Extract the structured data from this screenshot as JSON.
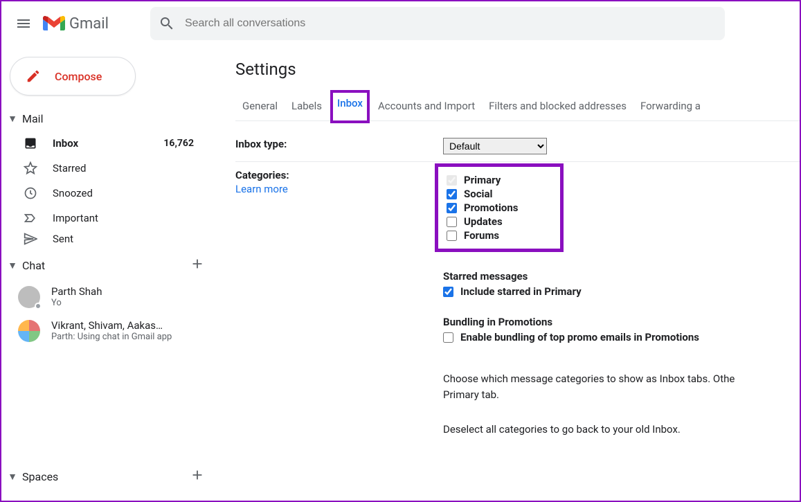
{
  "header": {
    "app_name": "Gmail",
    "search_placeholder": "Search all conversations"
  },
  "compose_label": "Compose",
  "sections": {
    "mail": "Mail",
    "chat": "Chat",
    "spaces": "Spaces"
  },
  "nav": {
    "inbox": {
      "label": "Inbox",
      "count": "16,762"
    },
    "starred": {
      "label": "Starred"
    },
    "snoozed": {
      "label": "Snoozed"
    },
    "important": {
      "label": "Important"
    },
    "sent": {
      "label": "Sent"
    }
  },
  "chats": [
    {
      "name": "Parth Shah",
      "sub": "Yo"
    },
    {
      "name": "Vikrant, Shivam, Aakas…",
      "sub": "Parth: Using chat in Gmail app"
    }
  ],
  "main": {
    "title": "Settings",
    "tabs": {
      "general": "General",
      "labels": "Labels",
      "inbox": "Inbox",
      "accounts": "Accounts and Import",
      "filters": "Filters and blocked addresses",
      "forwarding": "Forwarding a"
    },
    "inbox_type_label": "Inbox type:",
    "inbox_type_value": "Default",
    "categories_label": "Categories:",
    "learn_more": "Learn more",
    "cats": {
      "primary": {
        "label": "Primary",
        "checked": true,
        "disabled": true
      },
      "social": {
        "label": "Social",
        "checked": true
      },
      "promotions": {
        "label": "Promotions",
        "checked": true
      },
      "updates": {
        "label": "Updates",
        "checked": false
      },
      "forums": {
        "label": "Forums",
        "checked": false
      }
    },
    "starred_heading": "Starred messages",
    "starred_check": {
      "label": "Include starred in Primary",
      "checked": true
    },
    "bundling_heading": "Bundling in Promotions",
    "bundling_check": {
      "label": "Enable bundling of top promo emails in Promotions",
      "checked": false
    },
    "help1": "Choose which message categories to show as Inbox tabs. Othe",
    "help1b": "Primary tab.",
    "help2": "Deselect all categories to go back to your old Inbox."
  }
}
